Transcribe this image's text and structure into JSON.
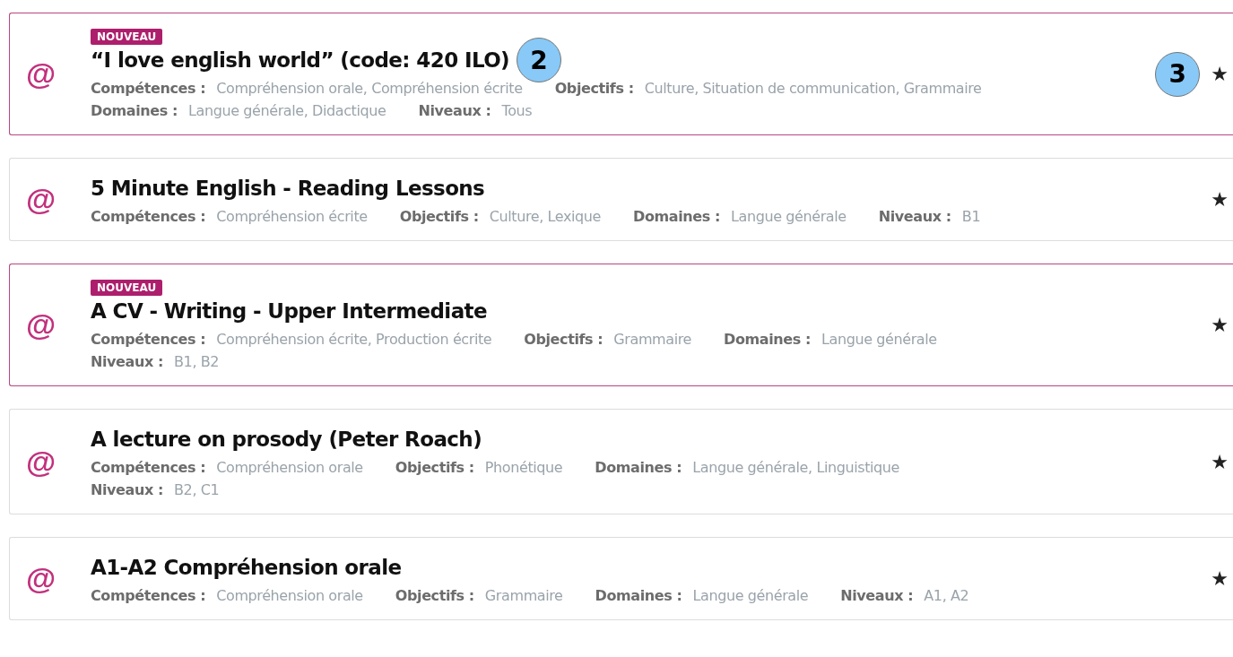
{
  "resources": [
    {
      "icon": "@",
      "badge": "NOUVEAU",
      "is_new": true,
      "title": "“I love english world” (code: 420 ILO)",
      "title_callout": "2",
      "star_callout": "3",
      "star": "★",
      "meta_lines": [
        [
          {
            "label": "Compétences :",
            "value": "Compréhension orale, Compréhension écrite"
          },
          {
            "label": "Objectifs :",
            "value": "Culture, Situation de communication, Grammaire"
          }
        ],
        [
          {
            "label": "Domaines :",
            "value": "Langue générale, Didactique"
          },
          {
            "label": "Niveaux :",
            "value": "Tous"
          }
        ]
      ]
    },
    {
      "icon": "@",
      "is_new": false,
      "title": "5 Minute English - Reading Lessons",
      "star": "★",
      "meta_lines": [
        [
          {
            "label": "Compétences :",
            "value": "Compréhension écrite"
          },
          {
            "label": "Objectifs :",
            "value": "Culture, Lexique"
          },
          {
            "label": "Domaines :",
            "value": "Langue générale"
          },
          {
            "label": "Niveaux :",
            "value": "B1"
          }
        ]
      ]
    },
    {
      "icon": "@",
      "badge": "NOUVEAU",
      "is_new": true,
      "title": "A CV - Writing - Upper Intermediate",
      "star": "★",
      "meta_lines": [
        [
          {
            "label": "Compétences :",
            "value": "Compréhension écrite, Production écrite"
          },
          {
            "label": "Objectifs :",
            "value": "Grammaire"
          },
          {
            "label": "Domaines :",
            "value": "Langue générale"
          }
        ],
        [
          {
            "label": "Niveaux :",
            "value": "B1, B2"
          }
        ]
      ]
    },
    {
      "icon": "@",
      "is_new": false,
      "title": "A lecture on prosody (Peter Roach)",
      "star": "★",
      "meta_lines": [
        [
          {
            "label": "Compétences :",
            "value": "Compréhension orale"
          },
          {
            "label": "Objectifs :",
            "value": "Phonétique"
          },
          {
            "label": "Domaines :",
            "value": "Langue générale, Linguistique"
          }
        ],
        [
          {
            "label": "Niveaux :",
            "value": "B2, C1"
          }
        ]
      ]
    },
    {
      "icon": "@",
      "is_new": false,
      "title": "A1-A2 Compréhension orale",
      "star": "★",
      "meta_lines": [
        [
          {
            "label": "Compétences :",
            "value": "Compréhension orale"
          },
          {
            "label": "Objectifs :",
            "value": "Grammaire"
          },
          {
            "label": "Domaines :",
            "value": "Langue générale"
          },
          {
            "label": "Niveaux :",
            "value": "A1, A2"
          }
        ]
      ]
    }
  ]
}
